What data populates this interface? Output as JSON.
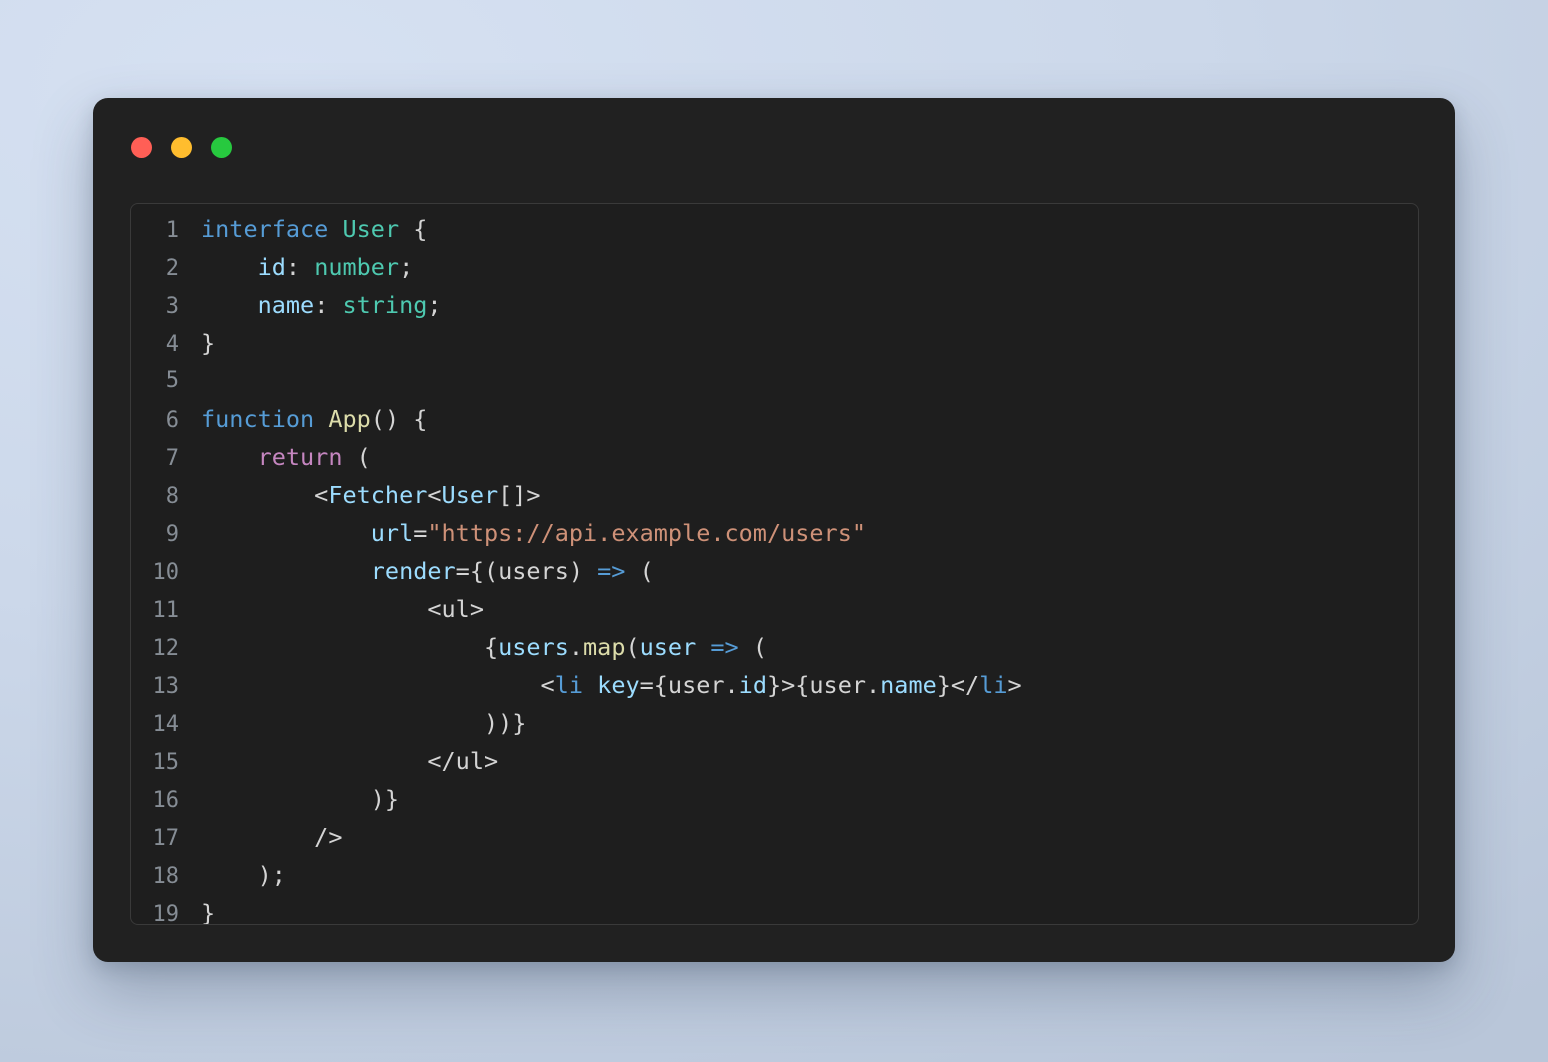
{
  "window": {
    "traffic_lights": [
      {
        "name": "close",
        "color": "#ff5f56"
      },
      {
        "name": "minimize",
        "color": "#ffbd2e"
      },
      {
        "name": "maximize",
        "color": "#27c93f"
      }
    ],
    "background_color": "#212121",
    "panel_color": "#1e1e1e"
  },
  "editor": {
    "language": "TypeScript React (TSX)",
    "line_count": 19,
    "line_numbers": [
      "1",
      "2",
      "3",
      "4",
      "5",
      "6",
      "7",
      "8",
      "9",
      "10",
      "11",
      "12",
      "13",
      "14",
      "15",
      "16",
      "17",
      "18",
      "19"
    ],
    "lines": [
      {
        "n": "1",
        "text": "interface User {"
      },
      {
        "n": "2",
        "text": "    id: number;"
      },
      {
        "n": "3",
        "text": "    name: string;"
      },
      {
        "n": "4",
        "text": "}"
      },
      {
        "n": "5",
        "text": ""
      },
      {
        "n": "6",
        "text": "function App() {"
      },
      {
        "n": "7",
        "text": "    return ("
      },
      {
        "n": "8",
        "text": "        <Fetcher<User[]>"
      },
      {
        "n": "9",
        "text": "            url=\"https://api.example.com/users\""
      },
      {
        "n": "10",
        "text": "            render={(users) => ("
      },
      {
        "n": "11",
        "text": "                <ul>"
      },
      {
        "n": "12",
        "text": "                    {users.map(user => ("
      },
      {
        "n": "13",
        "text": "                        <li key={user.id}>{user.name}</li>"
      },
      {
        "n": "14",
        "text": "                    ))}"
      },
      {
        "n": "15",
        "text": "                </ul>"
      },
      {
        "n": "16",
        "text": "            )}"
      },
      {
        "n": "17",
        "text": "        />"
      },
      {
        "n": "18",
        "text": "    );"
      },
      {
        "n": "19",
        "text": "}"
      }
    ],
    "tokens": {
      "l1": [
        [
          "interface",
          "t-kw"
        ],
        [
          " ",
          "t-pln"
        ],
        [
          "User",
          "t-type"
        ],
        [
          " {",
          "t-pln"
        ]
      ],
      "l2": [
        [
          "    ",
          "t-pln"
        ],
        [
          "id",
          "t-var"
        ],
        [
          ": ",
          "t-pln"
        ],
        [
          "number",
          "t-type"
        ],
        [
          ";",
          "t-pln"
        ]
      ],
      "l3": [
        [
          "    ",
          "t-pln"
        ],
        [
          "name",
          "t-var"
        ],
        [
          ": ",
          "t-pln"
        ],
        [
          "string",
          "t-type"
        ],
        [
          ";",
          "t-pln"
        ]
      ],
      "l4": [
        [
          "}",
          "t-pln"
        ]
      ],
      "l5": [
        [
          "",
          "t-pln"
        ]
      ],
      "l6": [
        [
          "function",
          "t-kw"
        ],
        [
          " ",
          "t-pln"
        ],
        [
          "App",
          "t-fn"
        ],
        [
          "() {",
          "t-pln"
        ]
      ],
      "l7": [
        [
          "    ",
          "t-pln"
        ],
        [
          "return",
          "t-ctl"
        ],
        [
          " (",
          "t-pln"
        ]
      ],
      "l8": [
        [
          "        <",
          "t-pln"
        ],
        [
          "Fetcher",
          "t-var"
        ],
        [
          "<",
          "t-pln"
        ],
        [
          "User",
          "t-var"
        ],
        [
          "[]>",
          "t-pln"
        ]
      ],
      "l9": [
        [
          "            ",
          "t-pln"
        ],
        [
          "url",
          "t-var"
        ],
        [
          "=",
          "t-pln"
        ],
        [
          "\"https://api.example.com/users\"",
          "t-str"
        ]
      ],
      "l10": [
        [
          "            ",
          "t-pln"
        ],
        [
          "render",
          "t-var"
        ],
        [
          "={(users) ",
          "t-pln"
        ],
        [
          "=>",
          "t-op"
        ],
        [
          " (",
          "t-pln"
        ]
      ],
      "l11": [
        [
          "                <ul>",
          "t-pln"
        ]
      ],
      "l12": [
        [
          "                    {",
          "t-pln"
        ],
        [
          "users",
          "t-var"
        ],
        [
          ".",
          "t-pln"
        ],
        [
          "map",
          "t-fn"
        ],
        [
          "(",
          "t-pln"
        ],
        [
          "user",
          "t-var"
        ],
        [
          " ",
          "t-pln"
        ],
        [
          "=>",
          "t-op"
        ],
        [
          " (",
          "t-pln"
        ]
      ],
      "l13": [
        [
          "                        <",
          "t-pln"
        ],
        [
          "li",
          "t-tag"
        ],
        [
          " ",
          "t-pln"
        ],
        [
          "key",
          "t-var"
        ],
        [
          "={user.",
          "t-pln"
        ],
        [
          "id",
          "t-var"
        ],
        [
          "}>{user.",
          "t-pln"
        ],
        [
          "name",
          "t-var"
        ],
        [
          "}</",
          "t-pln"
        ],
        [
          "li",
          "t-tag"
        ],
        [
          ">",
          "t-pln"
        ]
      ],
      "l14": [
        [
          "                    ))}",
          "t-pln"
        ]
      ],
      "l15": [
        [
          "                </ul>",
          "t-pln"
        ]
      ],
      "l16": [
        [
          "            )}",
          "t-pln"
        ]
      ],
      "l17": [
        [
          "        />",
          "t-pln"
        ]
      ],
      "l18": [
        [
          "    );",
          "t-pln"
        ]
      ],
      "l19": [
        [
          "}",
          "t-pln"
        ]
      ]
    },
    "colors": {
      "keyword": "#569cd6",
      "type": "#4ec9b0",
      "variable": "#9cdcfe",
      "function": "#dcdcaa",
      "string": "#ce9178",
      "plain": "#d4d4d4",
      "control": "#c586c0",
      "line_number": "#868d95"
    }
  }
}
